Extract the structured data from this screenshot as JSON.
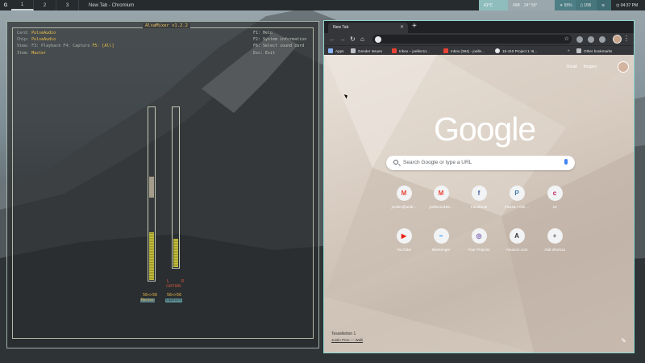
{
  "topbar": {
    "logo": "G",
    "workspaces": [
      "1",
      "2",
      "3"
    ],
    "active_workspace": "1",
    "window_title": "New Tab - Chromium",
    "stats": [
      "41°C",
      "49B",
      "24° 59°",
      "55%",
      "15B"
    ],
    "clock": "04:37 PM",
    "colors": {
      "temp_bg": "#8fbdbd",
      "stat_bg": "#9aa7ad",
      "cpu_bg": "#4e7e86",
      "mem_bg": "#47767d",
      "wifi_bg": "#3f6c73",
      "clock_bg": "#262b2e"
    }
  },
  "alsamixer": {
    "title": "AlsaMixer v1.2.2",
    "card_label": "Card:",
    "card_value": "PulseAudio",
    "chip_label": "Chip:",
    "chip_value": "PulseAudio",
    "view_label": "View:",
    "view_f3": "F3: Playback",
    "view_f4": "F4: Capture",
    "view_f5": "F5: [All]",
    "item_label": "Item:",
    "item_value": "Master",
    "help": [
      "F1:  Help",
      "F2:  System information",
      "F6:  Select sound card",
      "Esc: Exit"
    ],
    "channels": [
      {
        "name": "Master",
        "value_text": "56<>56",
        "level": 0.56
      },
      {
        "name": "Capture",
        "value_text": "56<>56",
        "level": 0.35,
        "lr_l": "L",
        "lr_r": "R",
        "caption": "CAPTURE"
      }
    ]
  },
  "chromium": {
    "tab_title": "New Tab",
    "bookmarks": [
      {
        "label": "Apps",
        "icon": "apps-grid-icon",
        "color": "#8ab4f8"
      },
      {
        "label": "Gender Issues",
        "icon": "folder-icon",
        "color": "#bdc1c6"
      },
      {
        "label": "Inbox – joellen11...",
        "icon": "gmail-icon",
        "color": "#ea4335"
      },
      {
        "label": "Inbox (364) - joelle...",
        "icon": "gmail-icon",
        "color": "#ea4335"
      },
      {
        "label": "15-410 Project 1: B...",
        "icon": "globe-icon",
        "color": "#e8eaed"
      }
    ],
    "other_bookmarks": "Other bookmarks",
    "ntp": {
      "links": [
        "Gmail",
        "Images"
      ],
      "logo": "Google",
      "search_placeholder": "Search Google or type a URL",
      "shortcuts": [
        {
          "label": "joellen@andr...",
          "glyph": "M",
          "color": "#ea4335"
        },
        {
          "label": "joellen11195...",
          "glyph": "M",
          "color": "#ea4335"
        },
        {
          "label": "Facebook",
          "glyph": "f",
          "color": "#3b5998"
        },
        {
          "label": "Piazza • Ask ...",
          "glyph": "P",
          "color": "#3e7aab"
        },
        {
          "label": "15",
          "glyph": "c",
          "color": "#c2185b"
        },
        {
          "label": "YouTube",
          "glyph": "▶",
          "color": "#e62117"
        },
        {
          "label": "Messenger",
          "glyph": "~",
          "color": "#0084ff"
        },
        {
          "label": "Your Projects",
          "glyph": "◎",
          "color": "#7b5fb0"
        },
        {
          "label": "Amazon.com",
          "glyph": "A",
          "color": "#333333"
        },
        {
          "label": "Add shortcut",
          "glyph": "+",
          "color": "#5f6368"
        }
      ],
      "attribution_title": "Tesselletion 1",
      "attribution_author": "Justin Prno — Walli"
    }
  }
}
